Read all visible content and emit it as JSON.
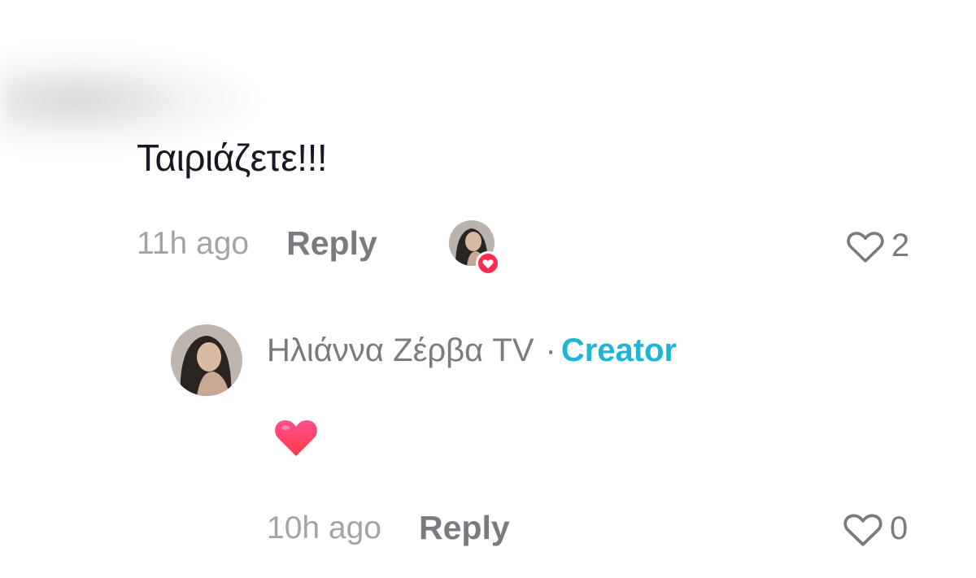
{
  "comment": {
    "text": "Ταιριάζετε!!!",
    "timestamp": "11h ago",
    "reply_label": "Reply",
    "like_count": "2",
    "liked_by_creator": true
  },
  "reply": {
    "author_name": "Ηλιάννα Ζέρβα TV",
    "separator": "·",
    "author_tag": "Creator",
    "emoji": "heart",
    "timestamp": "10h ago",
    "reply_label": "Reply",
    "like_count": "0"
  },
  "colors": {
    "text_primary": "#161823",
    "text_secondary": "#7a7b80",
    "creator_accent": "#20b4d6",
    "like_badge": "#fe2c55"
  }
}
